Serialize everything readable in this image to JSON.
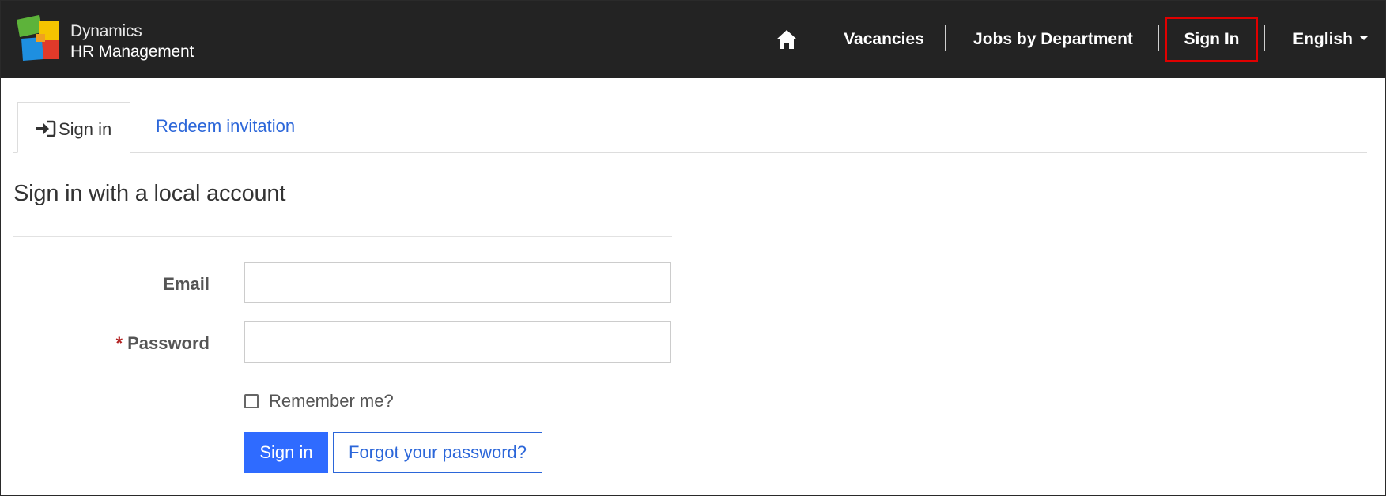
{
  "brand": {
    "line1": "Dynamics",
    "line2": "HR Management",
    "logo": "dynamics-puzzle-logo"
  },
  "nav": {
    "home_icon": "home-icon",
    "vacancies": "Vacancies",
    "jobs_by_department": "Jobs by Department",
    "sign_in": "Sign In",
    "language": "English"
  },
  "tabs": {
    "sign_in": "Sign in",
    "sign_in_icon": "sign-in-icon",
    "redeem": "Redeem invitation"
  },
  "form": {
    "title": "Sign in with a local account",
    "email_label": "Email",
    "email_value": "",
    "password_label": "Password",
    "password_required_marker": "*",
    "password_value": "",
    "remember_label": "Remember me?",
    "remember_checked": false,
    "submit_label": "Sign in",
    "forgot_label": "Forgot your password?"
  },
  "colors": {
    "navbar": "#232323",
    "primary": "#2f6bff",
    "link": "#2b66d9",
    "highlight_outline": "#e00000",
    "required": "#b22222"
  }
}
